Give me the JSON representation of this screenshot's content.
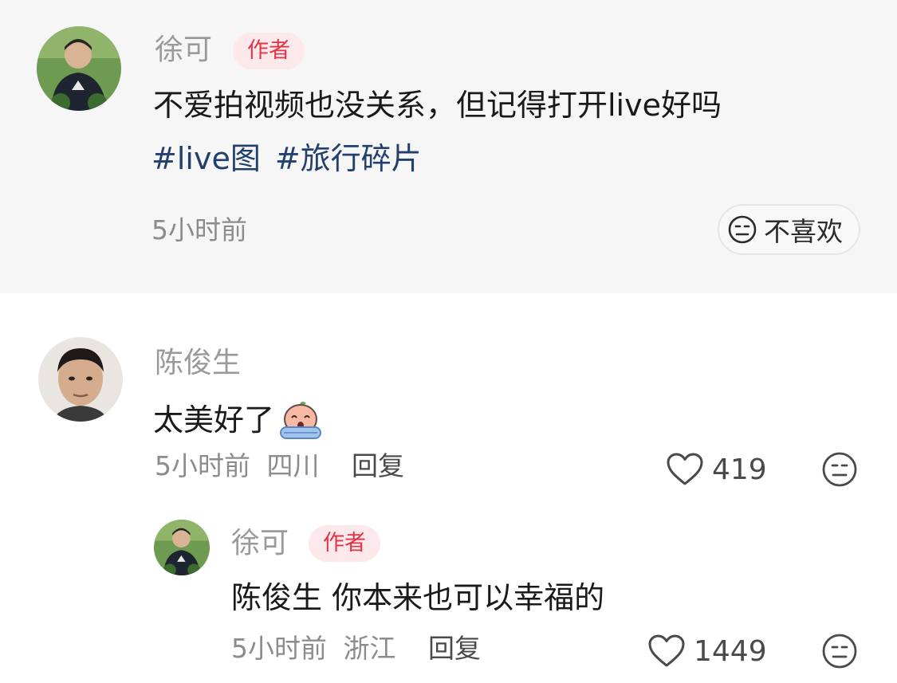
{
  "post": {
    "author": "徐可",
    "author_badge": "作者",
    "text": "不爱拍视频也没关系，但记得打开live好吗",
    "hashtags": [
      "#live图",
      "#旅行碎片"
    ],
    "time": "5小时前",
    "dislike_label": "不喜欢",
    "avatar_icon": "user-avatar-photo"
  },
  "comments": [
    {
      "name": "陈俊生",
      "text": "太美好了",
      "emoji": "crying-face-emoji",
      "time": "5小时前",
      "location": "四川",
      "reply_label": "回复",
      "likes": "419"
    }
  ],
  "replies": [
    {
      "name": "徐可",
      "badge": "作者",
      "text": "陈俊生 你本来也可以幸福的",
      "time": "5小时前",
      "location": "浙江",
      "reply_label": "回复",
      "likes": "1449"
    }
  ],
  "colors": {
    "background_post": "#f6f6f6",
    "badge_bg": "#fde9ec",
    "badge_text": "#e23445",
    "hashtag": "#23406d",
    "muted_text": "#9a9a9a"
  }
}
